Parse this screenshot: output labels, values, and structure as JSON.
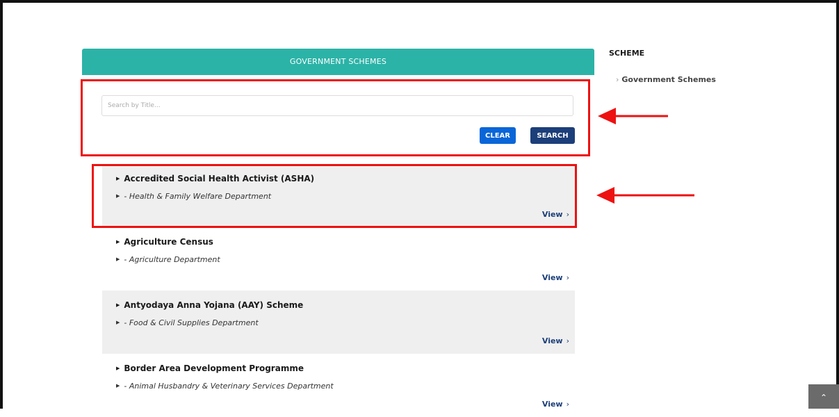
{
  "header": {
    "title": "GOVERNMENT SCHEMES"
  },
  "search": {
    "placeholder": "Search by Title...",
    "value": "",
    "clear_label": "CLEAR",
    "search_label": "SEARCH"
  },
  "schemes": [
    {
      "title": "Accredited Social Health Activist (ASHA)",
      "department": "- Health & Family Welfare Department",
      "view_label": "View"
    },
    {
      "title": "Agriculture Census",
      "department": "- Agriculture Department",
      "view_label": "View"
    },
    {
      "title": "Antyodaya Anna Yojana (AAY) Scheme",
      "department": "- Food & Civil Supplies Department",
      "view_label": "View"
    },
    {
      "title": "Border Area Development Programme",
      "department": "- Animal Husbandry & Veterinary Services Department",
      "view_label": "View"
    }
  ],
  "sidebar": {
    "title": "SCHEME",
    "items": [
      {
        "label": "Government Schemes"
      }
    ]
  },
  "icons": {
    "bullet": "triangle-right-icon",
    "view": "chevron-right-icon",
    "sidebar_item": "chevron-right-icon",
    "scroll_top": "chevron-up-icon",
    "annotation": "arrow-left-icon"
  },
  "colors": {
    "header_bg": "#2bb3a7",
    "clear_button": "#0a66d8",
    "search_button": "#1c3f7a",
    "highlight": "#ee1111",
    "shaded_row": "#efefef",
    "link": "#1c3f7a"
  }
}
